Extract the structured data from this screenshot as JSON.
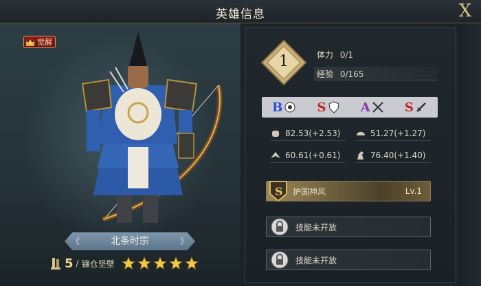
{
  "window": {
    "title": "英雄信息",
    "close_label": "X"
  },
  "hero": {
    "awaken_label": "觉醒",
    "name": "北条时宗",
    "troop_count": "5",
    "troop_separator": "/",
    "troop_name": "镰仓坚壁",
    "stars": 5,
    "name_chevron_left": "《",
    "name_chevron_right": "》"
  },
  "info": {
    "level": "1",
    "stamina": {
      "label": "体力",
      "value": "0/1"
    },
    "experience": {
      "label": "经验",
      "value": "0/165"
    },
    "grades": [
      {
        "letter": "B",
        "color": "#2b4fd6",
        "icon": "lion-icon"
      },
      {
        "letter": "S",
        "color": "#c42323",
        "icon": "shield-icon"
      },
      {
        "letter": "A",
        "color": "#8f2fb0",
        "icon": "crossed-arrows-icon"
      },
      {
        "letter": "S",
        "color": "#c42323",
        "icon": "sword-icon"
      }
    ],
    "attributes": [
      {
        "icon": "fist-icon",
        "value": "82.53(+2.53)"
      },
      {
        "icon": "helmet-icon",
        "value": "51.27(+1.27)"
      },
      {
        "icon": "wing-icon",
        "value": "60.61(+0.61)"
      },
      {
        "icon": "horse-icon",
        "value": "76.40(+1.40)"
      }
    ],
    "skills": [
      {
        "name": "护国神风",
        "level": "Lv.1",
        "badge": "S",
        "locked": false
      },
      {
        "name": "技能未开放",
        "locked": true
      },
      {
        "name": "技能未开放",
        "locked": true
      }
    ]
  },
  "colors": {
    "gold": "#d8c08a",
    "panel": "#20282e",
    "awaken_red": "#8f1b1b"
  }
}
